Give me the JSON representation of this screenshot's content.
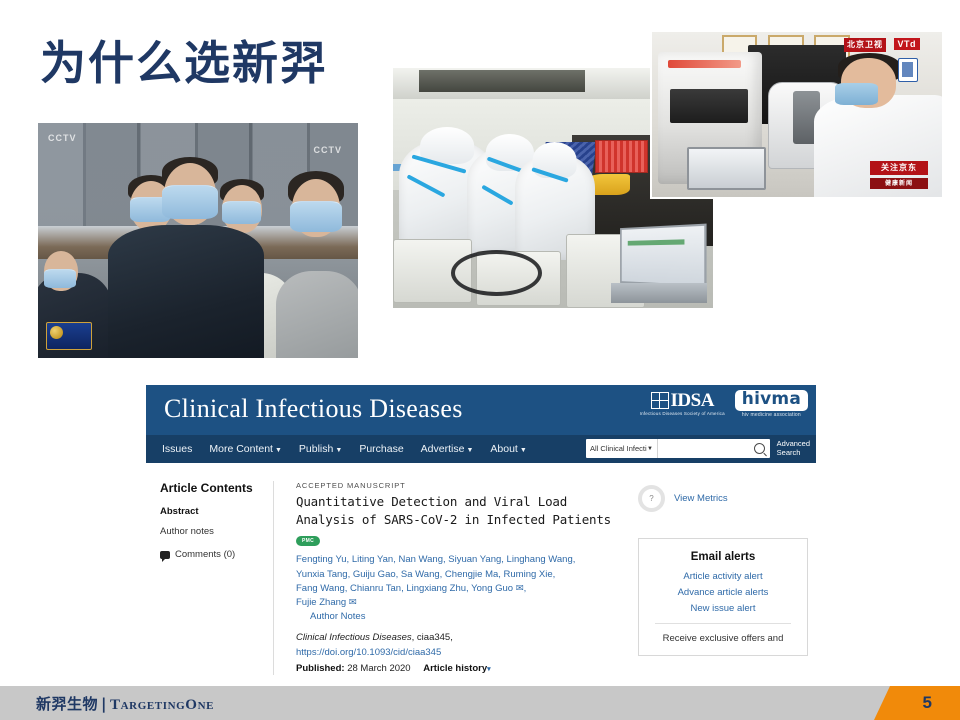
{
  "slide": {
    "title": "为什么选新羿",
    "page_number": "5",
    "accent_blue": "#1f3864",
    "accent_orange": "#f18a0a",
    "footer_gray": "#c8c8c8"
  },
  "photos": {
    "cctv": {
      "name": "officials-in-masks-laboratory-visit",
      "watermark_left": "CCTV",
      "watermark_right": "CCTV"
    },
    "lab": {
      "name": "technicians-in-ppe-suits-at-workstations"
    },
    "btv": {
      "name": "technician-operating-instrument",
      "watermark_top": "北京卫视",
      "watermark_vtd": "VTd",
      "watermark_bottom": "关注京东",
      "watermark_bottom_sub": "健康新闻"
    }
  },
  "journal": {
    "masthead": "Clinical Infectious Diseases",
    "idsa": {
      "word": "IDSA",
      "tagline": "Infectious Diseases Society of America"
    },
    "hivma": {
      "word": "hivma",
      "tagline": "hiv medicine association"
    },
    "nav": [
      {
        "label": "Issues",
        "caret": false
      },
      {
        "label": "More Content",
        "caret": true
      },
      {
        "label": "Publish",
        "caret": true
      },
      {
        "label": "Purchase",
        "caret": false
      },
      {
        "label": "Advertise",
        "caret": true
      },
      {
        "label": "About",
        "caret": true
      }
    ],
    "search": {
      "scope_value": "All Clinical Infecti",
      "input_placeholder": "",
      "input_value": "",
      "advanced_line1": "Advanced",
      "advanced_line2": "Search"
    },
    "toc": {
      "title": "Article Contents",
      "items": [
        {
          "label": "Abstract",
          "bold": true
        },
        {
          "label": "Author notes",
          "bold": false
        }
      ],
      "comments": "Comments (0)"
    },
    "article": {
      "kicker": "ACCEPTED MANUSCRIPT",
      "title_line1": "Quantitative Detection and Viral Load",
      "title_line2": "Analysis of SARS-CoV-2 in Infected Patients",
      "pmc_badge": "PMC",
      "authors_line1": "Fengting Yu, Liting Yan, Nan Wang, Siyuan Yang, Linghang Wang,",
      "authors_line2": "Yunxia Tang, Guiju Gao, Sa Wang, Chengjie Ma, Ruming Xie,",
      "authors_line3": "Fang Wang, Chianru Tan, Lingxiang Zhu, Yong Guo ✉,",
      "authors_line4": "Fujie Zhang ✉",
      "author_notes": "Author Notes",
      "journal_italic": "Clinical Infectious Diseases",
      "citation_rest": ", ciaa345,",
      "doi": "https://doi.org/10.1093/cid/ciaa345",
      "published_label": "Published:",
      "published_date": "28 March 2020",
      "article_history": "Article history"
    },
    "sidebar": {
      "metrics_label": "View Metrics",
      "metrics_donut": "?",
      "alerts_title": "Email alerts",
      "alerts": [
        "Article activity alert",
        "Advance article alerts",
        "New issue alert"
      ],
      "alerts_footer": "Receive exclusive offers and"
    }
  },
  "footer": {
    "logo_cn": "新羿生物",
    "logo_sep": "|",
    "logo_en": "TargetingOne"
  }
}
